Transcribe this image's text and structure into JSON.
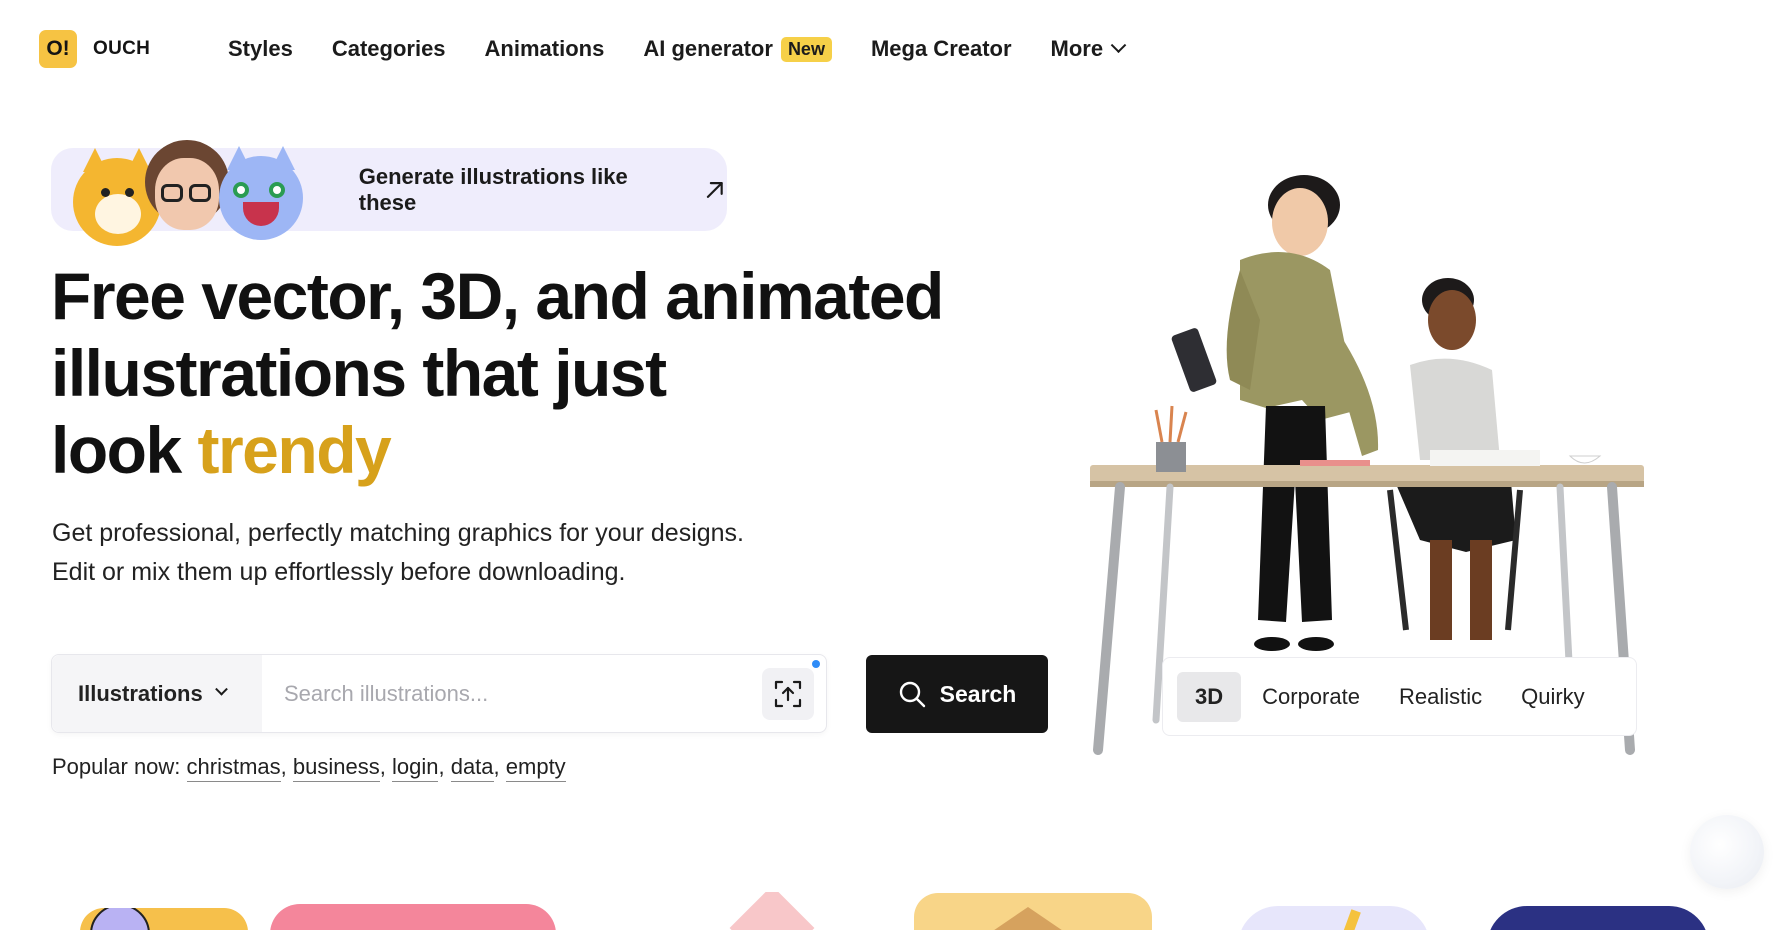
{
  "brand": {
    "logo_mark": "O!",
    "name": "OUCH"
  },
  "nav": {
    "items": [
      {
        "label": "Styles"
      },
      {
        "label": "Categories"
      },
      {
        "label": "Animations"
      },
      {
        "label": "AI generator",
        "badge": "New"
      },
      {
        "label": "Mega Creator"
      },
      {
        "label": "More"
      }
    ]
  },
  "promo": {
    "label": "Generate illustrations like these"
  },
  "hero": {
    "title_line1": "Free vector, 3D, and animated",
    "title_line2": "illustrations that just",
    "title_line3_prefix": "look ",
    "title_line3_accent": "trendy",
    "subtitle_line1": "Get professional, perfectly matching graphics for your designs.",
    "subtitle_line2": "Edit or mix them up effortlessly before downloading."
  },
  "search": {
    "type_label": "Illustrations",
    "placeholder": "Search illustrations...",
    "value": "",
    "button_label": "Search"
  },
  "popular": {
    "label": "Popular now:",
    "tags": [
      "christmas",
      "business",
      "login",
      "data",
      "empty"
    ]
  },
  "style_tabs": {
    "items": [
      "3D",
      "Corporate",
      "Realistic",
      "Quirky"
    ],
    "active": "3D"
  },
  "colors": {
    "accent": "#d7a11b",
    "logo_bg": "#f6c343",
    "badge_bg": "#f6d048",
    "promo_bg": "#efedfc",
    "button_dark": "#161616"
  }
}
